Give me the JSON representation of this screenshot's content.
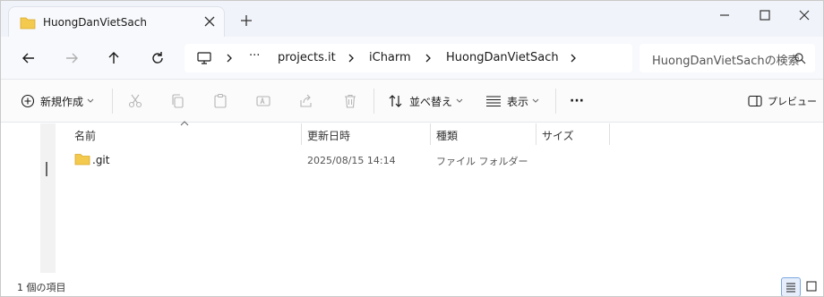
{
  "window": {
    "tab_title": "HuongDanVietSach",
    "colors": {
      "folder": "#f3c94e",
      "accent": "#0067c0"
    }
  },
  "address_bar": {
    "breadcrumbs": [
      "projects.it",
      "iCharm",
      "HuongDanVietSach"
    ],
    "overflow": "···"
  },
  "search": {
    "text": "HuongDanVietSachの検索"
  },
  "toolbar": {
    "new_label": "新規作成",
    "sort_label": "並べ替え",
    "view_label": "表示",
    "more_label": "···",
    "preview_label": "プレビュー"
  },
  "columns": [
    "名前",
    "更新日時",
    "種類",
    "サイズ"
  ],
  "files": [
    {
      "name": ".git",
      "modified": "2025/08/15 14:14",
      "type": "ファイル フォルダー",
      "size": ""
    }
  ],
  "status": {
    "item_count": "1 個の項目"
  }
}
